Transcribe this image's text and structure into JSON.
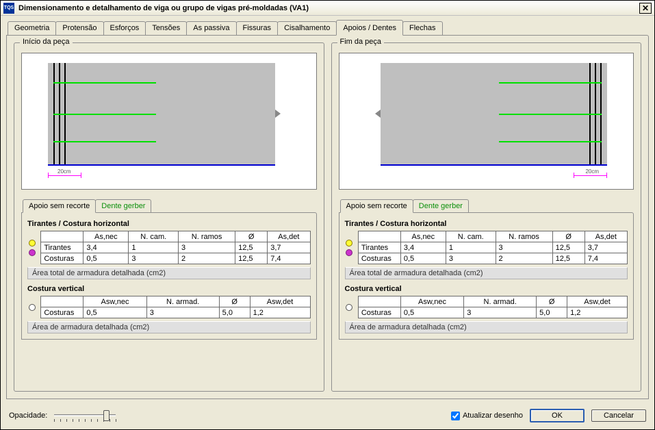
{
  "window": {
    "title": "Dimensionamento e detalhamento de viga ou grupo de vigas pré-moldadas (VA1)"
  },
  "tabs": [
    {
      "label": "Geometria"
    },
    {
      "label": "Protensão"
    },
    {
      "label": "Esforços"
    },
    {
      "label": "Tensões"
    },
    {
      "label": "As passiva"
    },
    {
      "label": "Fissuras"
    },
    {
      "label": "Cisalhamento"
    },
    {
      "label": "Apoios / Dentes"
    },
    {
      "label": "Flechas"
    }
  ],
  "active_tab_index": 7,
  "panels": {
    "left": {
      "legend": "Início da peça",
      "dim_text": "20cm",
      "subtabs": [
        {
          "label": "Apoio sem recorte"
        },
        {
          "label": "Dente gerber"
        }
      ],
      "active_subtab": 0,
      "section1_title": "Tirantes / Costura horizontal",
      "table1": {
        "cols": [
          "",
          "As,nec",
          "N. cam.",
          "N. ramos",
          "Ø",
          "As,det"
        ],
        "rows": [
          {
            "head": "Tirantes",
            "cells": [
              "3,4",
              "1",
              "3",
              "12,5",
              "3,7"
            ]
          },
          {
            "head": "Costuras",
            "cells": [
              "0,5",
              "3",
              "2",
              "12,5",
              "7,4"
            ]
          }
        ]
      },
      "footer1": "Área total de armadura detalhada (cm2)",
      "section2_title": "Costura vertical",
      "table2": {
        "cols": [
          "",
          "Asw,nec",
          "N. armad.",
          "Ø",
          "Asw,det"
        ],
        "rows": [
          {
            "head": "Costuras",
            "cells": [
              "0,5",
              "3",
              "5,0",
              "1,2"
            ]
          }
        ]
      },
      "footer2": "Área de armadura detalhada (cm2)"
    },
    "right": {
      "legend": "Fim da peça",
      "dim_text": "20cm",
      "subtabs": [
        {
          "label": "Apoio sem recorte"
        },
        {
          "label": "Dente gerber"
        }
      ],
      "active_subtab": 0,
      "section1_title": "Tirantes / Costura horizontal",
      "table1": {
        "cols": [
          "",
          "As,nec",
          "N. cam.",
          "N. ramos",
          "Ø",
          "As,det"
        ],
        "rows": [
          {
            "head": "Tirantes",
            "cells": [
              "3,4",
              "1",
              "3",
              "12,5",
              "3,7"
            ]
          },
          {
            "head": "Costuras",
            "cells": [
              "0,5",
              "3",
              "2",
              "12,5",
              "7,4"
            ]
          }
        ]
      },
      "footer1": "Área total de armadura detalhada (cm2)",
      "section2_title": "Costura vertical",
      "table2": {
        "cols": [
          "",
          "Asw,nec",
          "N. armad.",
          "Ø",
          "Asw,det"
        ],
        "rows": [
          {
            "head": "Costuras",
            "cells": [
              "0,5",
              "3",
              "5,0",
              "1,2"
            ]
          }
        ]
      },
      "footer2": "Área de armadura detalhada (cm2)"
    }
  },
  "bottom": {
    "opacity_label": "Opacidade:",
    "checkbox_label": "Atualizar desenho",
    "checkbox_checked": true,
    "ok": "OK",
    "cancel": "Cancelar"
  }
}
